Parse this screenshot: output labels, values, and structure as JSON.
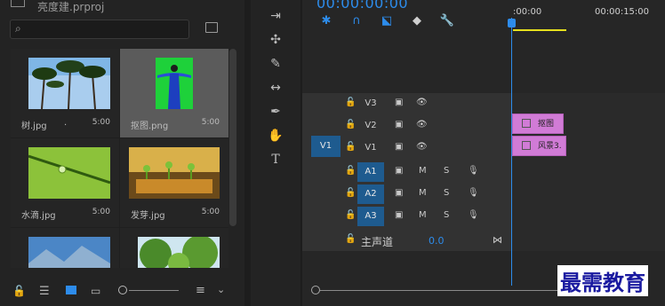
{
  "project": {
    "title": "亮度建.prproj",
    "search_placeholder": ""
  },
  "items": [
    {
      "name": "树.jpg",
      "extra": ".",
      "duration": "5:00"
    },
    {
      "name": "抠图.png",
      "extra": "",
      "duration": "5:00"
    },
    {
      "name": "水滴.jpg",
      "extra": "",
      "duration": "5:00"
    },
    {
      "name": "发芽.jpg",
      "extra": "",
      "duration": "5:00"
    }
  ],
  "timeline": {
    "timecode": "00:00:00:00",
    "ruler": {
      "t0": ":00:00",
      "t1": "00:00:15:00"
    },
    "tracks": {
      "v3": "V3",
      "v2": "V2",
      "v1": "V1",
      "a1": "A1",
      "a2": "A2",
      "a3": "A3",
      "src_v1": "V1",
      "m": "M",
      "s": "S"
    },
    "master": {
      "label": "主声道",
      "value": "0.0"
    },
    "clips": {
      "c1": "抠图",
      "c2": "风景3."
    }
  },
  "watermark": "最需教育",
  "colors": {
    "accent": "#2d8ceb",
    "clip": "#d17bd6",
    "track_blue": "#1e5b8f"
  }
}
